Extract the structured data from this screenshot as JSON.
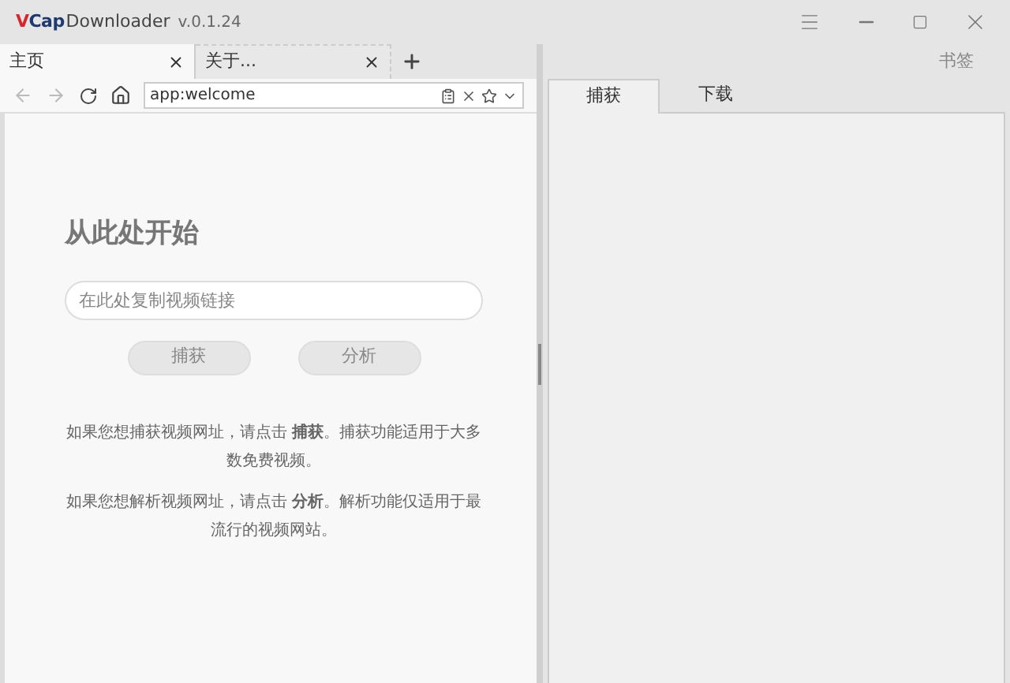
{
  "window": {
    "logo": "VCap",
    "app_name": "Downloader",
    "version": "v.0.1.24"
  },
  "browser_tabs": [
    {
      "label": "主页",
      "selected": true
    },
    {
      "label": "关于...",
      "selected": false
    }
  ],
  "address": {
    "value": "app:welcome"
  },
  "bookmarks": "书签",
  "welcome": {
    "heading": "从此处开始",
    "link_field": {
      "placeholder": "在此处复制视频链接"
    },
    "buttons": [
      "捕获",
      "分析"
    ],
    "paragraphs": [
      "如果您想捕获视频网址，请点击 **捕获**。捕获功能适用于大多数免费视频。",
      "如果您想解析视频网址，请点击 **分析**。解析功能仅适用于最流行的视频网站。"
    ]
  },
  "panel_tabs": [
    {
      "label": "捕获",
      "selected": true
    },
    {
      "label": "下载",
      "selected": false
    }
  ]
}
